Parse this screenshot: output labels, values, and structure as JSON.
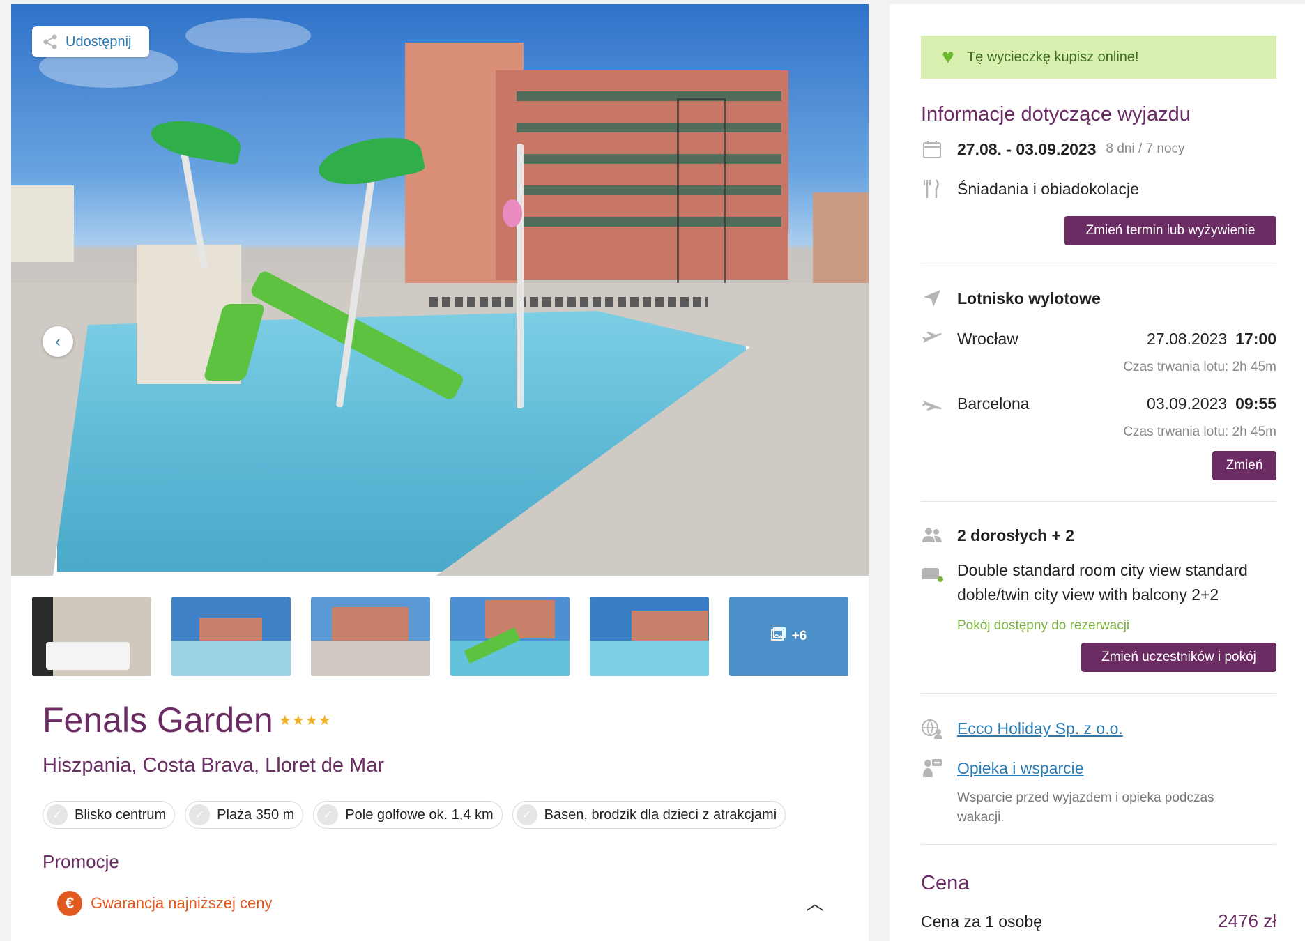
{
  "gallery": {
    "share_label": "Udostępnij",
    "more_count": "+6",
    "thumbnails": [
      "room",
      "pool-terrace",
      "hotel-pool",
      "water-slides",
      "kids-pool"
    ]
  },
  "hotel": {
    "name": "Fenals Garden",
    "stars": "★★★★",
    "location": "Hiszpania, Costa Brava, Lloret de Mar",
    "features": [
      "Blisko centrum",
      "Plaża 350 m",
      "Pole golfowe ok. 1,4 km",
      "Basen, brodzik dla dzieci z atrakcjami"
    ]
  },
  "promotions": {
    "title": "Promocje",
    "item": "Gwarancja najniższej ceny"
  },
  "sidebar": {
    "online_banner": "Tę wycieczkę kupisz online!",
    "trip_info_heading": "Informacje dotyczące wyjazdu",
    "dates": "27.08. - 03.09.2023",
    "duration": "8 dni / 7 nocy",
    "board": "Śniadania i obiadokolacje",
    "change_date_button": "Zmień termin lub wyżywienie",
    "airport_heading": "Lotnisko wylotowe",
    "outbound": {
      "city": "Wrocław",
      "date": "27.08.2023",
      "time": "17:00",
      "duration": "Czas trwania lotu: 2h 45m"
    },
    "return": {
      "city": "Barcelona",
      "date": "03.09.2023",
      "time": "09:55",
      "duration": "Czas trwania lotu: 2h 45m"
    },
    "change_flight_button": "Zmień",
    "participants": "2 dorosłych + 2",
    "room": "Double standard room city view standard doble/twin city view with balcony 2+2",
    "room_status": "Pokój dostępny do rezerwacji",
    "change_participants_button": "Zmień uczestników i pokój",
    "organizer_link": "Ecco Holiday Sp. z o.o.",
    "support_link": "Opieka i wsparcie",
    "support_desc": "Wsparcie przed wyjazdem i opieka podczas wakacji.",
    "price_heading": "Cena",
    "price_label": "Cena za 1 osobę",
    "price_value": "2476 zł"
  },
  "colors": {
    "brand_purple": "#6a2c63",
    "link_blue": "#2a7bb3",
    "available_green": "#7ab13c",
    "promo_orange": "#e05a1f",
    "banner_green": "#d9efb0"
  }
}
